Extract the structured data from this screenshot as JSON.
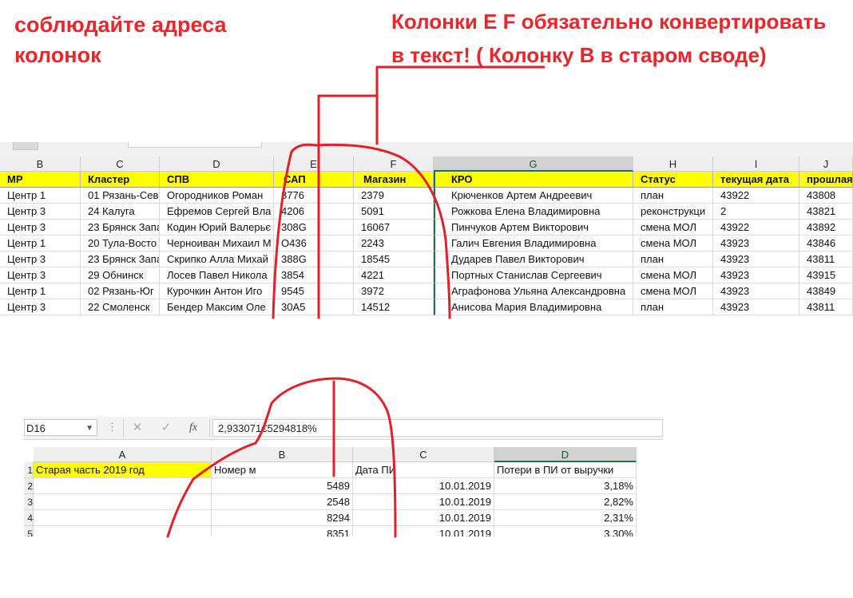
{
  "notes": {
    "left_line1": "соблюдайте адреса",
    "left_line2": "колонок",
    "right_line1": "Колонки E F обязательно конвертировать",
    "right_line2": "в текст! ( Колонку B в старом своде)"
  },
  "sheet1": {
    "columns": [
      "B",
      "C",
      "D",
      "E",
      "F",
      "G",
      "H",
      "I",
      "J"
    ],
    "selected_column": "G",
    "headers": [
      "МР",
      "Кластер",
      "СПВ",
      "САП",
      "Магазин",
      "КРО",
      "Статус",
      "текущая дата",
      "прошлая"
    ],
    "rows": [
      [
        "Центр 1",
        "01 Рязань-Сев",
        "Огородников Роман",
        "8776",
        "2379",
        "Крюченков Артем Андреевич",
        "план",
        "43922",
        "43808"
      ],
      [
        "Центр 3",
        "24 Калуга",
        "Ефремов Сергей Вла",
        "4206",
        "5091",
        "Рожкова Елена Владимировна",
        "реконструкци",
        "2",
        "43821"
      ],
      [
        "Центр 3",
        "23 Брянск Запа",
        "Кодин Юрий Валерьє",
        "308G",
        "16067",
        "Пинчуков Артем Викторович",
        "смена МОЛ",
        "43922",
        "43892"
      ],
      [
        "Центр 1",
        "20 Тула-Восто",
        "Черноиван Михаил М",
        "O436",
        "2243",
        "Галич Евгения Владимировна",
        "смена МОЛ",
        "43923",
        "43846"
      ],
      [
        "Центр 3",
        "23 Брянск Запа",
        "Скрипко Алла Михай",
        "388G",
        "18545",
        "Дударев Павел Викторович",
        "план",
        "43923",
        "43811"
      ],
      [
        "Центр 3",
        "29 Обнинск",
        "Лосев Павел Никола",
        "3854",
        "4221",
        "Портных Станислав Сергеевич",
        "смена МОЛ",
        "43923",
        "43915"
      ],
      [
        "Центр 1",
        "02 Рязань-Юг",
        "Курочкин Антон Иго",
        "9545",
        "3972",
        "Аграфонова Ульяна Александровна",
        "смена МОЛ",
        "43923",
        "43849"
      ],
      [
        "Центр 3",
        "22 Смоленск",
        "Бендер Максим Оле",
        "30A5",
        "14512",
        "Анисова Мария Владимировна",
        "план",
        "43923",
        "43811"
      ]
    ]
  },
  "sheet2": {
    "name_box": "D16",
    "formula_value": "2,933071€5294818%",
    "fx_label": "fx",
    "columns": [
      "A",
      "B",
      "C",
      "D"
    ],
    "selected_column": "D",
    "row_numbers": [
      "1",
      "2",
      "3",
      "4",
      "5"
    ],
    "header_row": [
      "Старая часть 2019 год",
      "Номер м",
      "Дата ПИ",
      "Потери в ПИ от выручки"
    ],
    "rows": [
      [
        "",
        "5489",
        "10.01.2019",
        "3,18%"
      ],
      [
        "",
        "2548",
        "10.01.2019",
        "2,82%"
      ],
      [
        "",
        "8294",
        "10.01.2019",
        "2,31%"
      ],
      [
        "",
        "8351",
        "10.01.2019",
        "3,30%"
      ]
    ]
  },
  "colors": {
    "annotation_red": "#e8262b",
    "header_yellow": "#ffff00",
    "excel_green": "#217346"
  }
}
